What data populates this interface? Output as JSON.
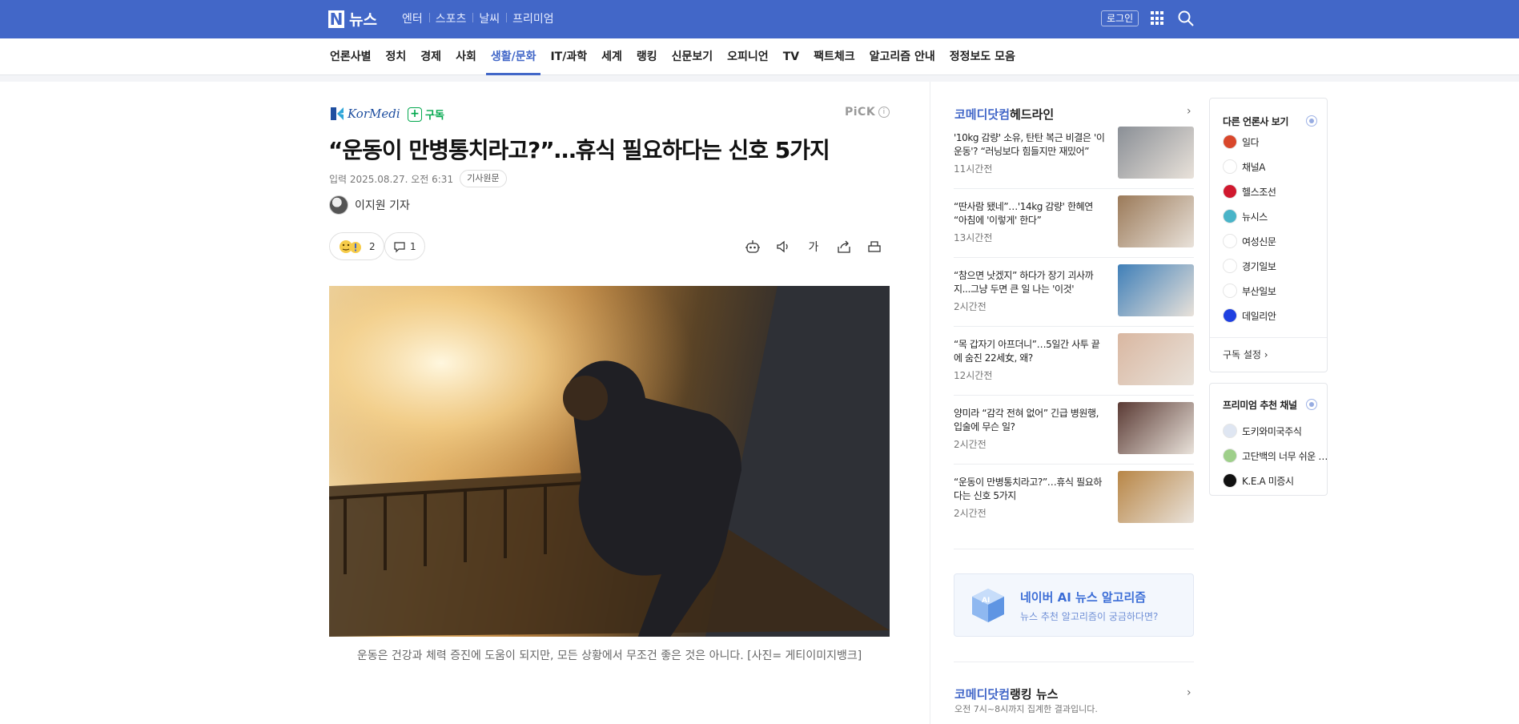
{
  "header": {
    "logo_letter": "N",
    "brand": "뉴스",
    "topnav": [
      "엔터",
      "스포츠",
      "날씨",
      "프리미엄"
    ],
    "login": "로그인"
  },
  "categories": [
    "언론사별",
    "정치",
    "경제",
    "사회",
    "생활/문화",
    "IT/과학",
    "세계",
    "랭킹",
    "신문보기",
    "오피니언",
    "TV",
    "팩트체크",
    "알고리즘 안내",
    "정정보도 모음"
  ],
  "active_category": "생활/문화",
  "article": {
    "press": "KorMedi",
    "subscribe": "구독",
    "pick": "PiCK",
    "pick_info": "i",
    "title": "“운동이 만병통치라고?”…휴식 필요하다는 신호 5가지",
    "date": "입력 2025.08.27. 오전 6:31",
    "original_btn": "기사원문",
    "author": "이지원 기자",
    "reactions": "2",
    "comments": "1",
    "tool_font": "가",
    "caption": "운동은 건강과 체력 증진에 도움이 되지만, 모든 상황에서 무조건 좋은 것은 아니다. [사진= 게티이미지뱅크]"
  },
  "headlines_section": {
    "press": "코메디닷컴",
    "label": " 헤드라인",
    "items": [
      {
        "title": "'10kg 감량' 소유, 탄탄 복근 비결은 '이 운동'? “러닝보다 힘들지만 재밌어”",
        "time": "11시간전",
        "color": "#8a8f96"
      },
      {
        "title": "“딴사람 됐네”…'14kg 감량' 한혜연 “아침에 '이렇게' 한다”",
        "time": "13시간전",
        "color": "#9b7a59"
      },
      {
        "title": "“참으면 낫겠지” 하다가 장기 괴사까지...그냥 두면 큰 일 나는 '이것'",
        "time": "2시간전",
        "color": "#3f7fb8"
      },
      {
        "title": "“목 갑자기 아프더니”…5일간 사투 끝에 숨진 22세女, 왜?",
        "time": "12시간전",
        "color": "#d9b7a1"
      },
      {
        "title": "양미라 “감각 전혀 없어” 긴급 병원행, 입술에 무슨 일?",
        "time": "2시간전",
        "color": "#5a3a34"
      },
      {
        "title": "“운동이 만병통치라고?”…휴식 필요하다는 신호 5가지",
        "time": "2시간전",
        "color": "#b88646"
      }
    ]
  },
  "ai_box": {
    "title": "네이버 AI 뉴스 알고리즘",
    "subtitle": "뉴스 추천 알고리즘이 궁금하다면?",
    "icon_text": "AI"
  },
  "ranking_section": {
    "press": "코메디닷컴",
    "label": " 랭킹 뉴스",
    "note": "오전 7시~8시까지 집계한 결과입니다."
  },
  "other_press": {
    "title": "다른 언론사 보기",
    "items": [
      {
        "name": "일다",
        "color": "#d9472b"
      },
      {
        "name": "채널A",
        "color": "#ffffff"
      },
      {
        "name": "헬스조선",
        "color": "#d0182e"
      },
      {
        "name": "뉴시스",
        "color": "#49b4c8"
      },
      {
        "name": "여성신문",
        "color": "#ffffff"
      },
      {
        "name": "경기일보",
        "color": "#ffffff"
      },
      {
        "name": "부산일보",
        "color": "#ffffff"
      },
      {
        "name": "데일리안",
        "color": "#1f40e0"
      }
    ],
    "setting": "구독 설정 ›"
  },
  "premium": {
    "title": "프리미엄 추천 채널",
    "items": [
      {
        "name": "도키와미국주식",
        "color": "#dfe6f2"
      },
      {
        "name": "고단백의 너무 쉬운 재테크",
        "color": "#9ecf8a"
      },
      {
        "name": "K.E.A 미증시",
        "color": "#111111"
      }
    ]
  }
}
